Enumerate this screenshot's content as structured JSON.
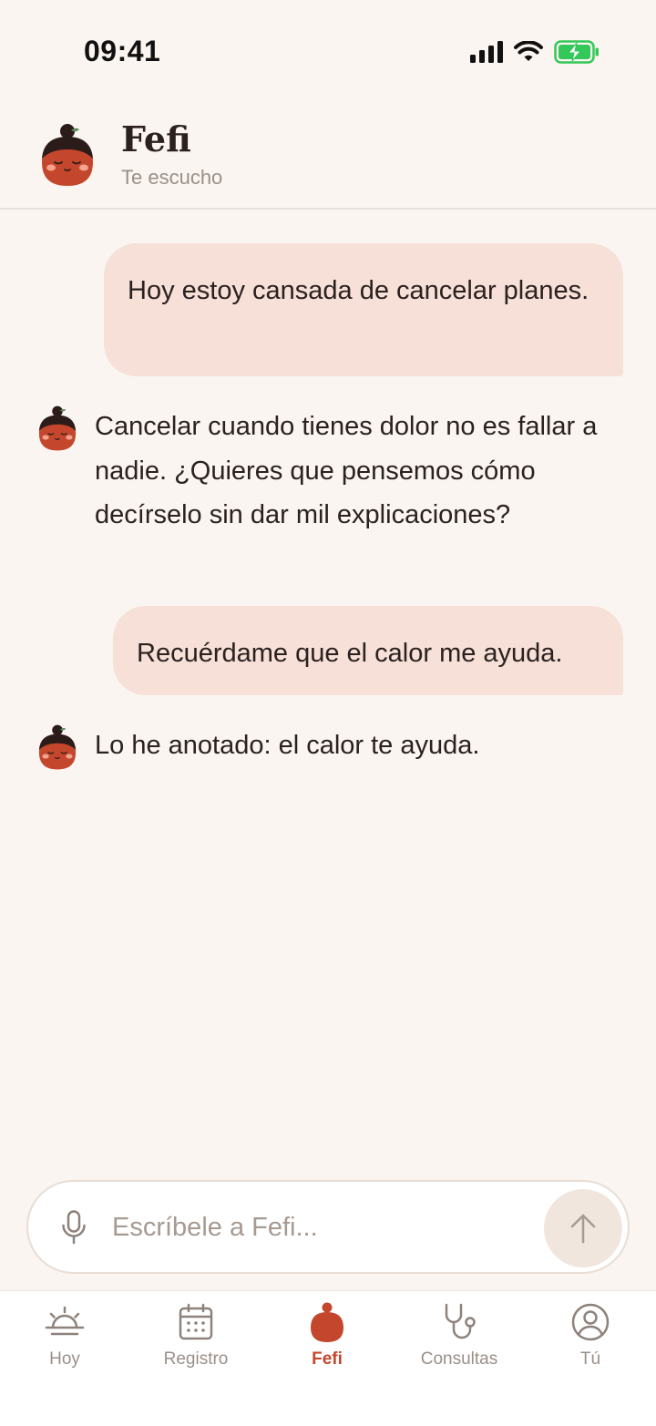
{
  "status_bar": {
    "time": "09:41"
  },
  "header": {
    "title": "Fefi",
    "subtitle": "Te escucho"
  },
  "messages": [
    {
      "from": "user",
      "text": "Hoy estoy cansada de cancelar planes."
    },
    {
      "from": "bot",
      "text": "Cancelar cuando tienes dolor no es fallar a nadie. ¿Quieres que pensemos cómo decírselo sin dar mil explicaciones?"
    },
    {
      "from": "user",
      "text": "Recuérdame que el calor me ayuda."
    },
    {
      "from": "bot",
      "text": "Lo he anotado: el calor te ayuda."
    }
  ],
  "composer": {
    "placeholder": "Escríbele a Fefi..."
  },
  "tabs": [
    {
      "label": "Hoy",
      "icon": "sunrise-icon"
    },
    {
      "label": "Registro",
      "icon": "calendar-icon"
    },
    {
      "label": "Fefi",
      "icon": "fefi-icon",
      "active": true
    },
    {
      "label": "Consultas",
      "icon": "stethoscope-icon"
    },
    {
      "label": "Tú",
      "icon": "profile-icon"
    }
  ],
  "colors": {
    "background": "#FAF5F0",
    "user_bubble": "#F6E0D8",
    "accent": "#C4462C",
    "muted": "#9A8F88"
  }
}
